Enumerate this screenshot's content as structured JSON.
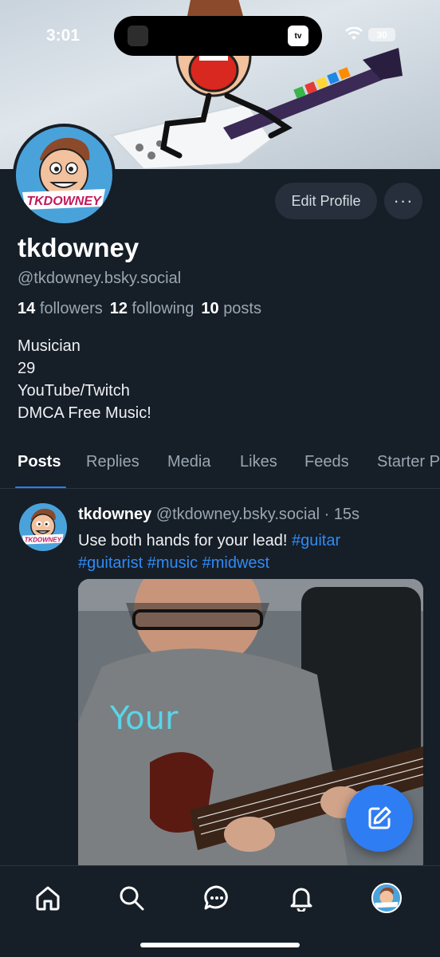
{
  "status_bar": {
    "time": "3:01",
    "battery": "30",
    "tv_label": "tv"
  },
  "profile": {
    "avatar_text": "TKDOWNEY",
    "edit_button": "Edit Profile",
    "more_button": "···",
    "display_name": "tkdowney",
    "handle": "@tkdowney.bsky.social",
    "followers_count": "14",
    "followers_label": "followers",
    "following_count": "12",
    "following_label": "following",
    "posts_count": "10",
    "posts_label": "posts",
    "bio": [
      "Musician",
      "29",
      "YouTube/Twitch",
      "DMCA Free Music!"
    ]
  },
  "tabs": [
    {
      "label": "Posts",
      "active": true
    },
    {
      "label": "Replies"
    },
    {
      "label": "Media"
    },
    {
      "label": "Likes"
    },
    {
      "label": "Feeds"
    },
    {
      "label": "Starter Packs"
    }
  ],
  "post": {
    "author": "tkdowney",
    "handle_time": "@tkdowney.bsky.social · 15s",
    "text_line1": "Use both hands for your lead! ",
    "tags": [
      "#guitar",
      "#guitarist",
      "#music",
      "#midwest"
    ],
    "media_caption": "Your"
  },
  "bottom_nav": [
    "home-icon",
    "search-icon",
    "chat-icon",
    "bell-icon",
    "profile-avatar"
  ],
  "colors": {
    "accent": "#2f7df3",
    "background": "#161e27",
    "link": "#2f8bf5"
  }
}
